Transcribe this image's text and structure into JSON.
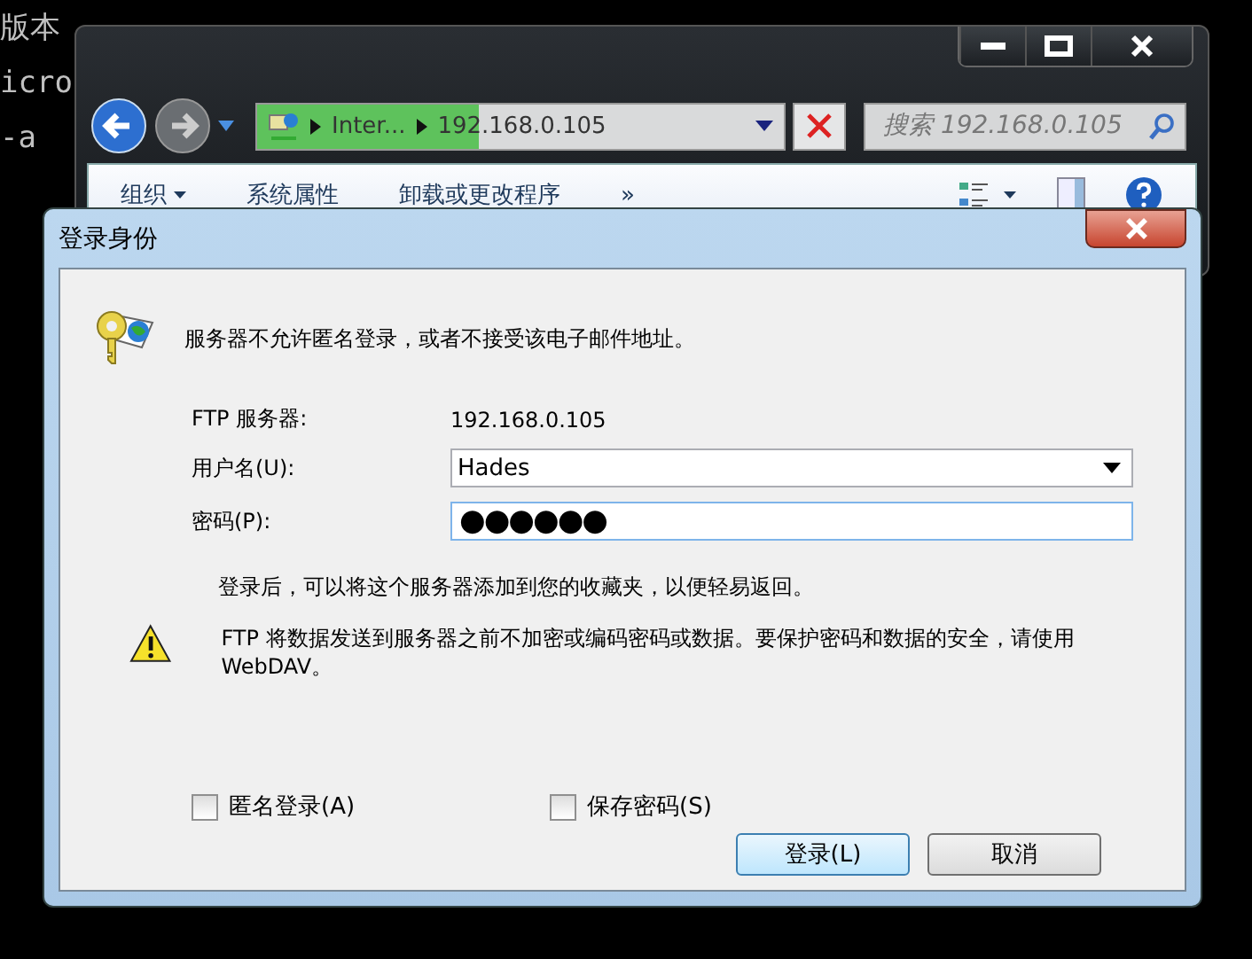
{
  "console": {
    "lines": [
      "版本",
      "icro",
      "-a"
    ]
  },
  "explorer": {
    "address": {
      "level": 0.42,
      "segments": [
        "Inter...",
        "192.168.0.105"
      ]
    },
    "search": {
      "placeholder": "搜索 192.168.0.105"
    },
    "toolbar": [
      {
        "label": "组织",
        "dropdown": true
      },
      {
        "label": "系统属性",
        "dropdown": false
      },
      {
        "label": "卸载或更改程序",
        "dropdown": false
      },
      {
        "label": "»",
        "dropdown": false
      }
    ]
  },
  "dialog": {
    "title": "登录身份",
    "message": "服务器不允许匿名登录，或者不接受该电子邮件地址。",
    "fields": [
      {
        "kind": "text",
        "label": "FTP 服务器:",
        "value": "192.168.0.105"
      },
      {
        "kind": "combo",
        "label": "用户名(U):",
        "value": "Hades"
      },
      {
        "kind": "password",
        "label": "密码(P):",
        "value": "●●●●●●"
      }
    ],
    "note": "登录后，可以将这个服务器添加到您的收藏夹，以便轻易返回。",
    "warning": "FTP 将数据发送到服务器之前不加密或编码密码或数据。要保护密码和数据的安全，请使用 WebDAV。",
    "checkboxes": [
      {
        "label": "匿名登录(A)",
        "checked": false
      },
      {
        "label": "保存密码(S)",
        "checked": false
      }
    ],
    "buttons": [
      {
        "label": "登录(L)",
        "default": true
      },
      {
        "label": "取消",
        "default": false
      }
    ]
  }
}
